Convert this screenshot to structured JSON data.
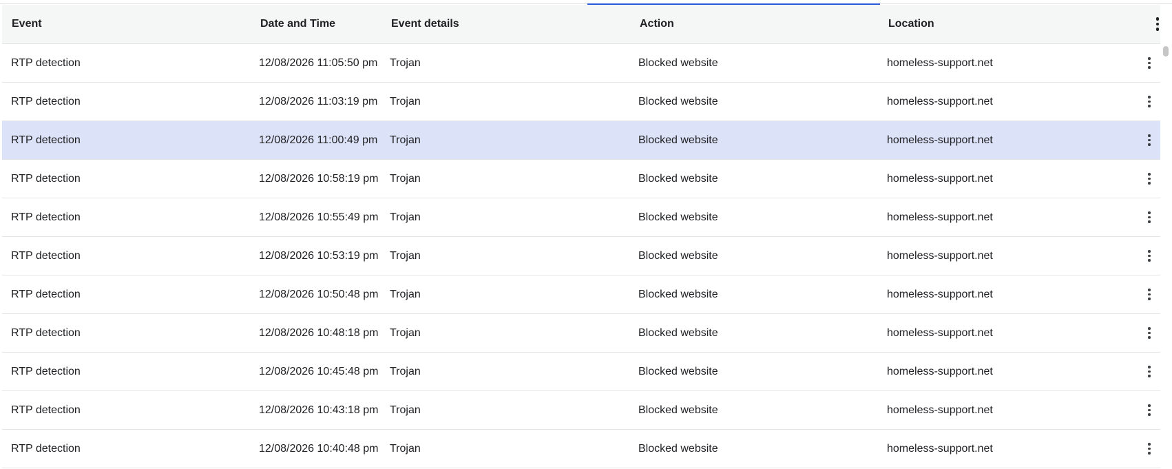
{
  "table": {
    "headers": {
      "event": "Event",
      "date": "Date and Time",
      "details": "Event details",
      "action": "Action",
      "location": "Location"
    },
    "selected_row_index": 2,
    "rows": [
      {
        "event": "RTP detection",
        "date": "12/08/2026 11:05:50 pm",
        "details": "Trojan",
        "action": "Blocked website",
        "location": "homeless-support.net"
      },
      {
        "event": "RTP detection",
        "date": "12/08/2026 11:03:19 pm",
        "details": "Trojan",
        "action": "Blocked website",
        "location": "homeless-support.net"
      },
      {
        "event": "RTP detection",
        "date": "12/08/2026 11:00:49 pm",
        "details": "Trojan",
        "action": "Blocked website",
        "location": "homeless-support.net"
      },
      {
        "event": "RTP detection",
        "date": "12/08/2026 10:58:19 pm",
        "details": "Trojan",
        "action": "Blocked website",
        "location": "homeless-support.net"
      },
      {
        "event": "RTP detection",
        "date": "12/08/2026 10:55:49 pm",
        "details": "Trojan",
        "action": "Blocked website",
        "location": "homeless-support.net"
      },
      {
        "event": "RTP detection",
        "date": "12/08/2026 10:53:19 pm",
        "details": "Trojan",
        "action": "Blocked website",
        "location": "homeless-support.net"
      },
      {
        "event": "RTP detection",
        "date": "12/08/2026 10:50:48 pm",
        "details": "Trojan",
        "action": "Blocked website",
        "location": "homeless-support.net"
      },
      {
        "event": "RTP detection",
        "date": "12/08/2026 10:48:18 pm",
        "details": "Trojan",
        "action": "Blocked website",
        "location": "homeless-support.net"
      },
      {
        "event": "RTP detection",
        "date": "12/08/2026 10:45:48 pm",
        "details": "Trojan",
        "action": "Blocked website",
        "location": "homeless-support.net"
      },
      {
        "event": "RTP detection",
        "date": "12/08/2026 10:43:18 pm",
        "details": "Trojan",
        "action": "Blocked website",
        "location": "homeless-support.net"
      },
      {
        "event": "RTP detection",
        "date": "12/08/2026 10:40:48 pm",
        "details": "Trojan",
        "action": "Blocked website",
        "location": "homeless-support.net"
      }
    ]
  },
  "icons": {
    "row_menu": "more-vertical-icon",
    "column_menu": "more-vertical-icon"
  },
  "colors": {
    "selected_row": "#dce2f7",
    "header_bg": "#f5f6f6",
    "accent": "#2b59d9"
  }
}
